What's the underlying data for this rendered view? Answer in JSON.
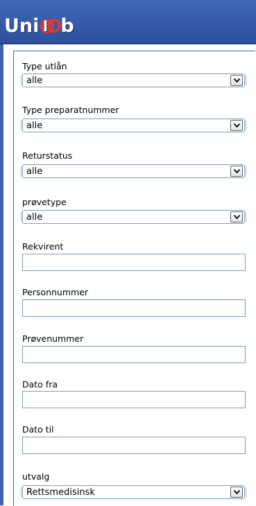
{
  "header": {
    "logo_text_start": "Uni",
    "logo_text_end": "b"
  },
  "form": {
    "type_utlan": {
      "label": "Type utlån",
      "value": "alle"
    },
    "type_preparatnummer": {
      "label": "Type preparatnummer",
      "value": "alle"
    },
    "returstatus": {
      "label": "Returstatus",
      "value": "alle"
    },
    "provetype": {
      "label": "prøvetype",
      "value": "alle"
    },
    "rekvirent": {
      "label": "Rekvirent",
      "value": ""
    },
    "personnummer": {
      "label": "Personnummer",
      "value": ""
    },
    "provenummer": {
      "label": "Prøvenummer",
      "value": ""
    },
    "dato_fra": {
      "label": "Dato fra",
      "value": ""
    },
    "dato_til": {
      "label": "Dato til",
      "value": ""
    },
    "utvalg": {
      "label": "utvalg",
      "value": "Rettsmedisinsk"
    }
  },
  "colors": {
    "header_blue": "#3f68b8",
    "logo_red": "#e2372a",
    "border": "#7f9db9"
  }
}
